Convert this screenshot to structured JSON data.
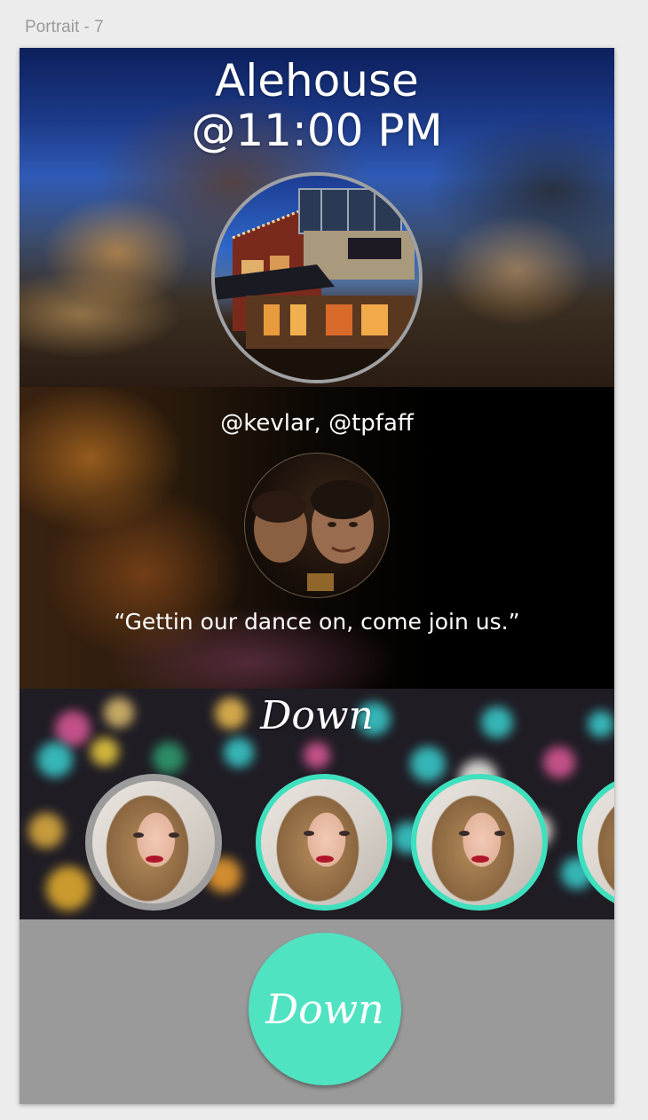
{
  "artboard": {
    "label": "Portrait - 7"
  },
  "event": {
    "venue": "Alehouse",
    "time": "@11:00 PM"
  },
  "host": {
    "mentions": "@kevlar, @tpfaff",
    "quote": "“Gettin our dance on, come join us.”"
  },
  "attendees_section": {
    "heading": "Down",
    "attendees": [
      {
        "ring": "gray"
      },
      {
        "ring": "teal"
      },
      {
        "ring": "teal"
      },
      {
        "ring": "teal"
      }
    ]
  },
  "footer": {
    "button_label": "Down"
  },
  "colors": {
    "accent": "#4fe3c1",
    "ring_teal": "#3fe0bd",
    "ring_gray": "#9c9c9c",
    "footer_bg": "#9a9a9a"
  }
}
